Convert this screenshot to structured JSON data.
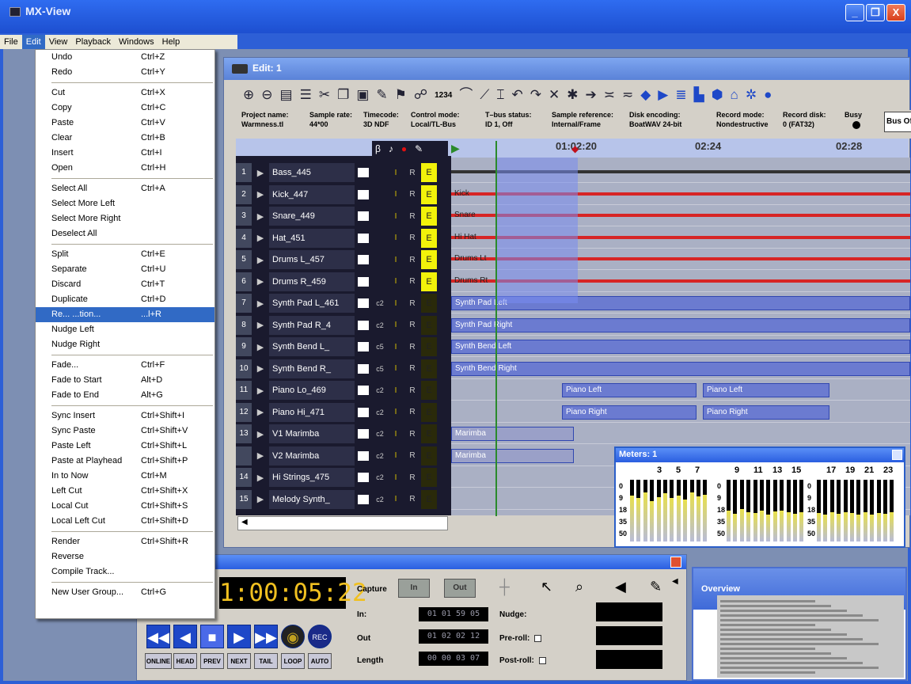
{
  "window": {
    "title": "MX-View",
    "minimize": "_",
    "restore": "❐",
    "close": "X"
  },
  "menubar": [
    "File",
    "Edit",
    "View",
    "Playback",
    "Windows",
    "Help"
  ],
  "edit_menu": {
    "items": [
      {
        "label": "Undo",
        "shortcut": "Ctrl+Z"
      },
      {
        "label": "Redo",
        "shortcut": "Ctrl+Y"
      },
      {
        "sep": true
      },
      {
        "label": "Cut",
        "shortcut": "Ctrl+X"
      },
      {
        "label": "Copy",
        "shortcut": "Ctrl+C"
      },
      {
        "label": "Paste",
        "shortcut": "Ctrl+V"
      },
      {
        "label": "Clear",
        "shortcut": "Ctrl+B"
      },
      {
        "label": "Insert",
        "shortcut": "Ctrl+I"
      },
      {
        "label": "Open",
        "shortcut": "Ctrl+H"
      },
      {
        "sep": true
      },
      {
        "label": "Select All",
        "shortcut": "Ctrl+A"
      },
      {
        "label": "Select More Left",
        "shortcut": ""
      },
      {
        "label": "Select More Right",
        "shortcut": ""
      },
      {
        "label": "Deselect All",
        "shortcut": ""
      },
      {
        "sep": true
      },
      {
        "label": "Split",
        "shortcut": "Ctrl+E"
      },
      {
        "label": "Separate",
        "shortcut": "Ctrl+U"
      },
      {
        "label": "Discard",
        "shortcut": "Ctrl+T"
      },
      {
        "label": "Duplicate",
        "shortcut": "Ctrl+D"
      },
      {
        "label": "Re... ...tion...",
        "shortcut": "...l+R",
        "highlighted": true
      },
      {
        "label": "Nudge Left",
        "shortcut": ""
      },
      {
        "label": "Nudge Right",
        "shortcut": ""
      },
      {
        "sep": true
      },
      {
        "label": "Fade...",
        "shortcut": "Ctrl+F"
      },
      {
        "label": "Fade to Start",
        "shortcut": "Alt+D"
      },
      {
        "label": "Fade to End",
        "shortcut": "Alt+G"
      },
      {
        "sep": true
      },
      {
        "label": "Sync Insert",
        "shortcut": "Ctrl+Shift+I"
      },
      {
        "label": "Sync Paste",
        "shortcut": "Ctrl+Shift+V"
      },
      {
        "label": "Paste Left",
        "shortcut": "Ctrl+Shift+L"
      },
      {
        "label": "Paste at Playhead",
        "shortcut": "Ctrl+Shift+P"
      },
      {
        "label": "In to Now",
        "shortcut": "Ctrl+M"
      },
      {
        "label": "Left Cut",
        "shortcut": "Ctrl+Shift+X"
      },
      {
        "label": "Local Cut",
        "shortcut": "Ctrl+Shift+S"
      },
      {
        "label": "Local Left Cut",
        "shortcut": "Ctrl+Shift+D"
      },
      {
        "sep": true
      },
      {
        "label": "Render",
        "shortcut": "Ctrl+Shift+R"
      },
      {
        "label": "Reverse",
        "shortcut": ""
      },
      {
        "label": "Compile Track...",
        "shortcut": ""
      },
      {
        "sep": true
      },
      {
        "label": "New User Group...",
        "shortcut": "Ctrl+G"
      }
    ]
  },
  "edit_window": {
    "title": "Edit: 1",
    "toolbar_digits": "1234",
    "info": {
      "project_name": {
        "label": "Project name:",
        "value": "Warmness.tl"
      },
      "sample_rate": {
        "label": "Sample rate:",
        "value": "44*00"
      },
      "timecode": {
        "label": "Timecode:",
        "value": "3D NDF"
      },
      "control_mode": {
        "label": "Control mode:",
        "value": "Local/TL-Bus"
      },
      "tl_bus_status": {
        "label": "T–bus status:",
        "value": "ID 1, Off"
      },
      "sample_reference": {
        "label": "Sample reference:",
        "value": "Internal/Frame"
      },
      "disk_encoding": {
        "label": "Disk encoding:",
        "value": "BoatWAV 24-bit"
      },
      "record_mode": {
        "label": "Record mode:",
        "value": "Nondestructive"
      },
      "record_disk": {
        "label": "Record disk:",
        "value": "0 (FAT32)"
      },
      "busy": {
        "label": "Busy"
      },
      "bus_offset": "Bus Offse"
    },
    "ruler": [
      "01:02:20",
      "02:24",
      "02:28"
    ],
    "tracks": [
      {
        "num": "1",
        "name": "Bass_445",
        "c": "",
        "red": false,
        "e": true
      },
      {
        "num": "2",
        "name": "Kick_447",
        "c": "",
        "red": true,
        "e": true
      },
      {
        "num": "3",
        "name": "Snare_449",
        "c": "",
        "red": true,
        "e": true
      },
      {
        "num": "4",
        "name": "Hat_451",
        "c": "",
        "red": true,
        "e": true
      },
      {
        "num": "5",
        "name": "Drums L_457",
        "c": "",
        "red": true,
        "e": true
      },
      {
        "num": "6",
        "name": "Drums R_459",
        "c": "",
        "red": true,
        "e": true
      },
      {
        "num": "7",
        "name": "Synth Pad L_461",
        "c": "c2",
        "red": false,
        "e": false
      },
      {
        "num": "8",
        "name": "Synth Pad R_4",
        "c": "c2",
        "red": false,
        "e": false
      },
      {
        "num": "9",
        "name": "Synth Bend L_",
        "c": "c5",
        "red": false,
        "e": false
      },
      {
        "num": "10",
        "name": "Synth Bend R_",
        "c": "c5",
        "red": false,
        "e": false
      },
      {
        "num": "11",
        "name": "Piano Lo_469",
        "c": "c2",
        "red": false,
        "e": false
      },
      {
        "num": "12",
        "name": "Piano Hi_471",
        "c": "c2",
        "red": false,
        "e": false
      },
      {
        "num": "13",
        "name": "V1 Marimba",
        "c": "c2",
        "red": false,
        "e": false
      },
      {
        "num": "",
        "name": "V2 Marimba",
        "c": "c2",
        "red": false,
        "e": false
      },
      {
        "num": "14",
        "name": "Hi Strings_475",
        "c": "c2",
        "red": false,
        "e": false
      },
      {
        "num": "15",
        "name": "Melody Synth_",
        "c": "c2",
        "red": false,
        "e": false
      }
    ],
    "col_r": "R",
    "col_i": "I",
    "col_e": "E",
    "clips": [
      {
        "lane": 1,
        "label": "Kick"
      },
      {
        "lane": 2,
        "label": "Snare"
      },
      {
        "lane": 3,
        "label": "Hi Hat"
      },
      {
        "lane": 4,
        "label": "Drums Lt"
      },
      {
        "lane": 5,
        "label": "Drums Rt"
      },
      {
        "lane": 6,
        "label": "Synth Pad Left"
      },
      {
        "lane": 7,
        "label": "Synth Pad Right"
      },
      {
        "lane": 8,
        "label": "Synth Bend Left"
      },
      {
        "lane": 9,
        "label": "Synth Bend Right"
      },
      {
        "lane": 10,
        "label": "Piano Left"
      },
      {
        "lane": 10,
        "label": "Piano Left"
      },
      {
        "lane": 11,
        "label": "Piano Right"
      },
      {
        "lane": 11,
        "label": "Piano Right"
      },
      {
        "lane": 12,
        "label": "Marimba"
      },
      {
        "lane": 13,
        "label": "Marimba"
      }
    ]
  },
  "meters": {
    "title": "Meters: 1",
    "channel_labels": [
      "3",
      "5",
      "7",
      "9",
      "11",
      "13",
      "15",
      "17",
      "19",
      "21",
      "23"
    ],
    "scale": [
      "0",
      "9",
      "18",
      "35",
      "50"
    ],
    "levels": [
      0.75,
      0.7,
      0.8,
      0.65,
      0.72,
      0.78,
      0.7,
      0.74,
      0.68,
      0.8,
      0.73,
      0.76,
      0.5,
      0.45,
      0.52,
      0.48,
      0.46,
      0.5,
      0.44,
      0.49,
      0.5,
      0.47,
      0.45,
      0.48,
      0.46,
      0.44,
      0.47,
      0.45,
      0.48,
      0.46,
      0.43,
      0.47,
      0.44,
      0.46,
      0.45,
      0.47
    ]
  },
  "transport": {
    "timecode": "1:00:05:22",
    "capture": "Capture",
    "in_btn": "In",
    "out_btn": "Out",
    "in_label": "In:",
    "in_value": "01 01 59 05",
    "out_label": "Out",
    "out_value": "01 02 02 12",
    "length_label": "Length",
    "length_value": "00 00 03 07",
    "nudge": "Nudge:",
    "preroll": "Pre-roll:",
    "postroll": "Post-roll:",
    "rec": "REC",
    "small_buttons": [
      "ONLINE",
      "HEAD",
      "PREV",
      "NEXT",
      "TAIL",
      "LOOP",
      "AUTO"
    ]
  },
  "overview": {
    "title": "Overview"
  },
  "colors": {
    "accent": "#316ac5",
    "title_blue": "#2a5ee0",
    "red": "#e01010",
    "yellow": "#f2f20a"
  }
}
